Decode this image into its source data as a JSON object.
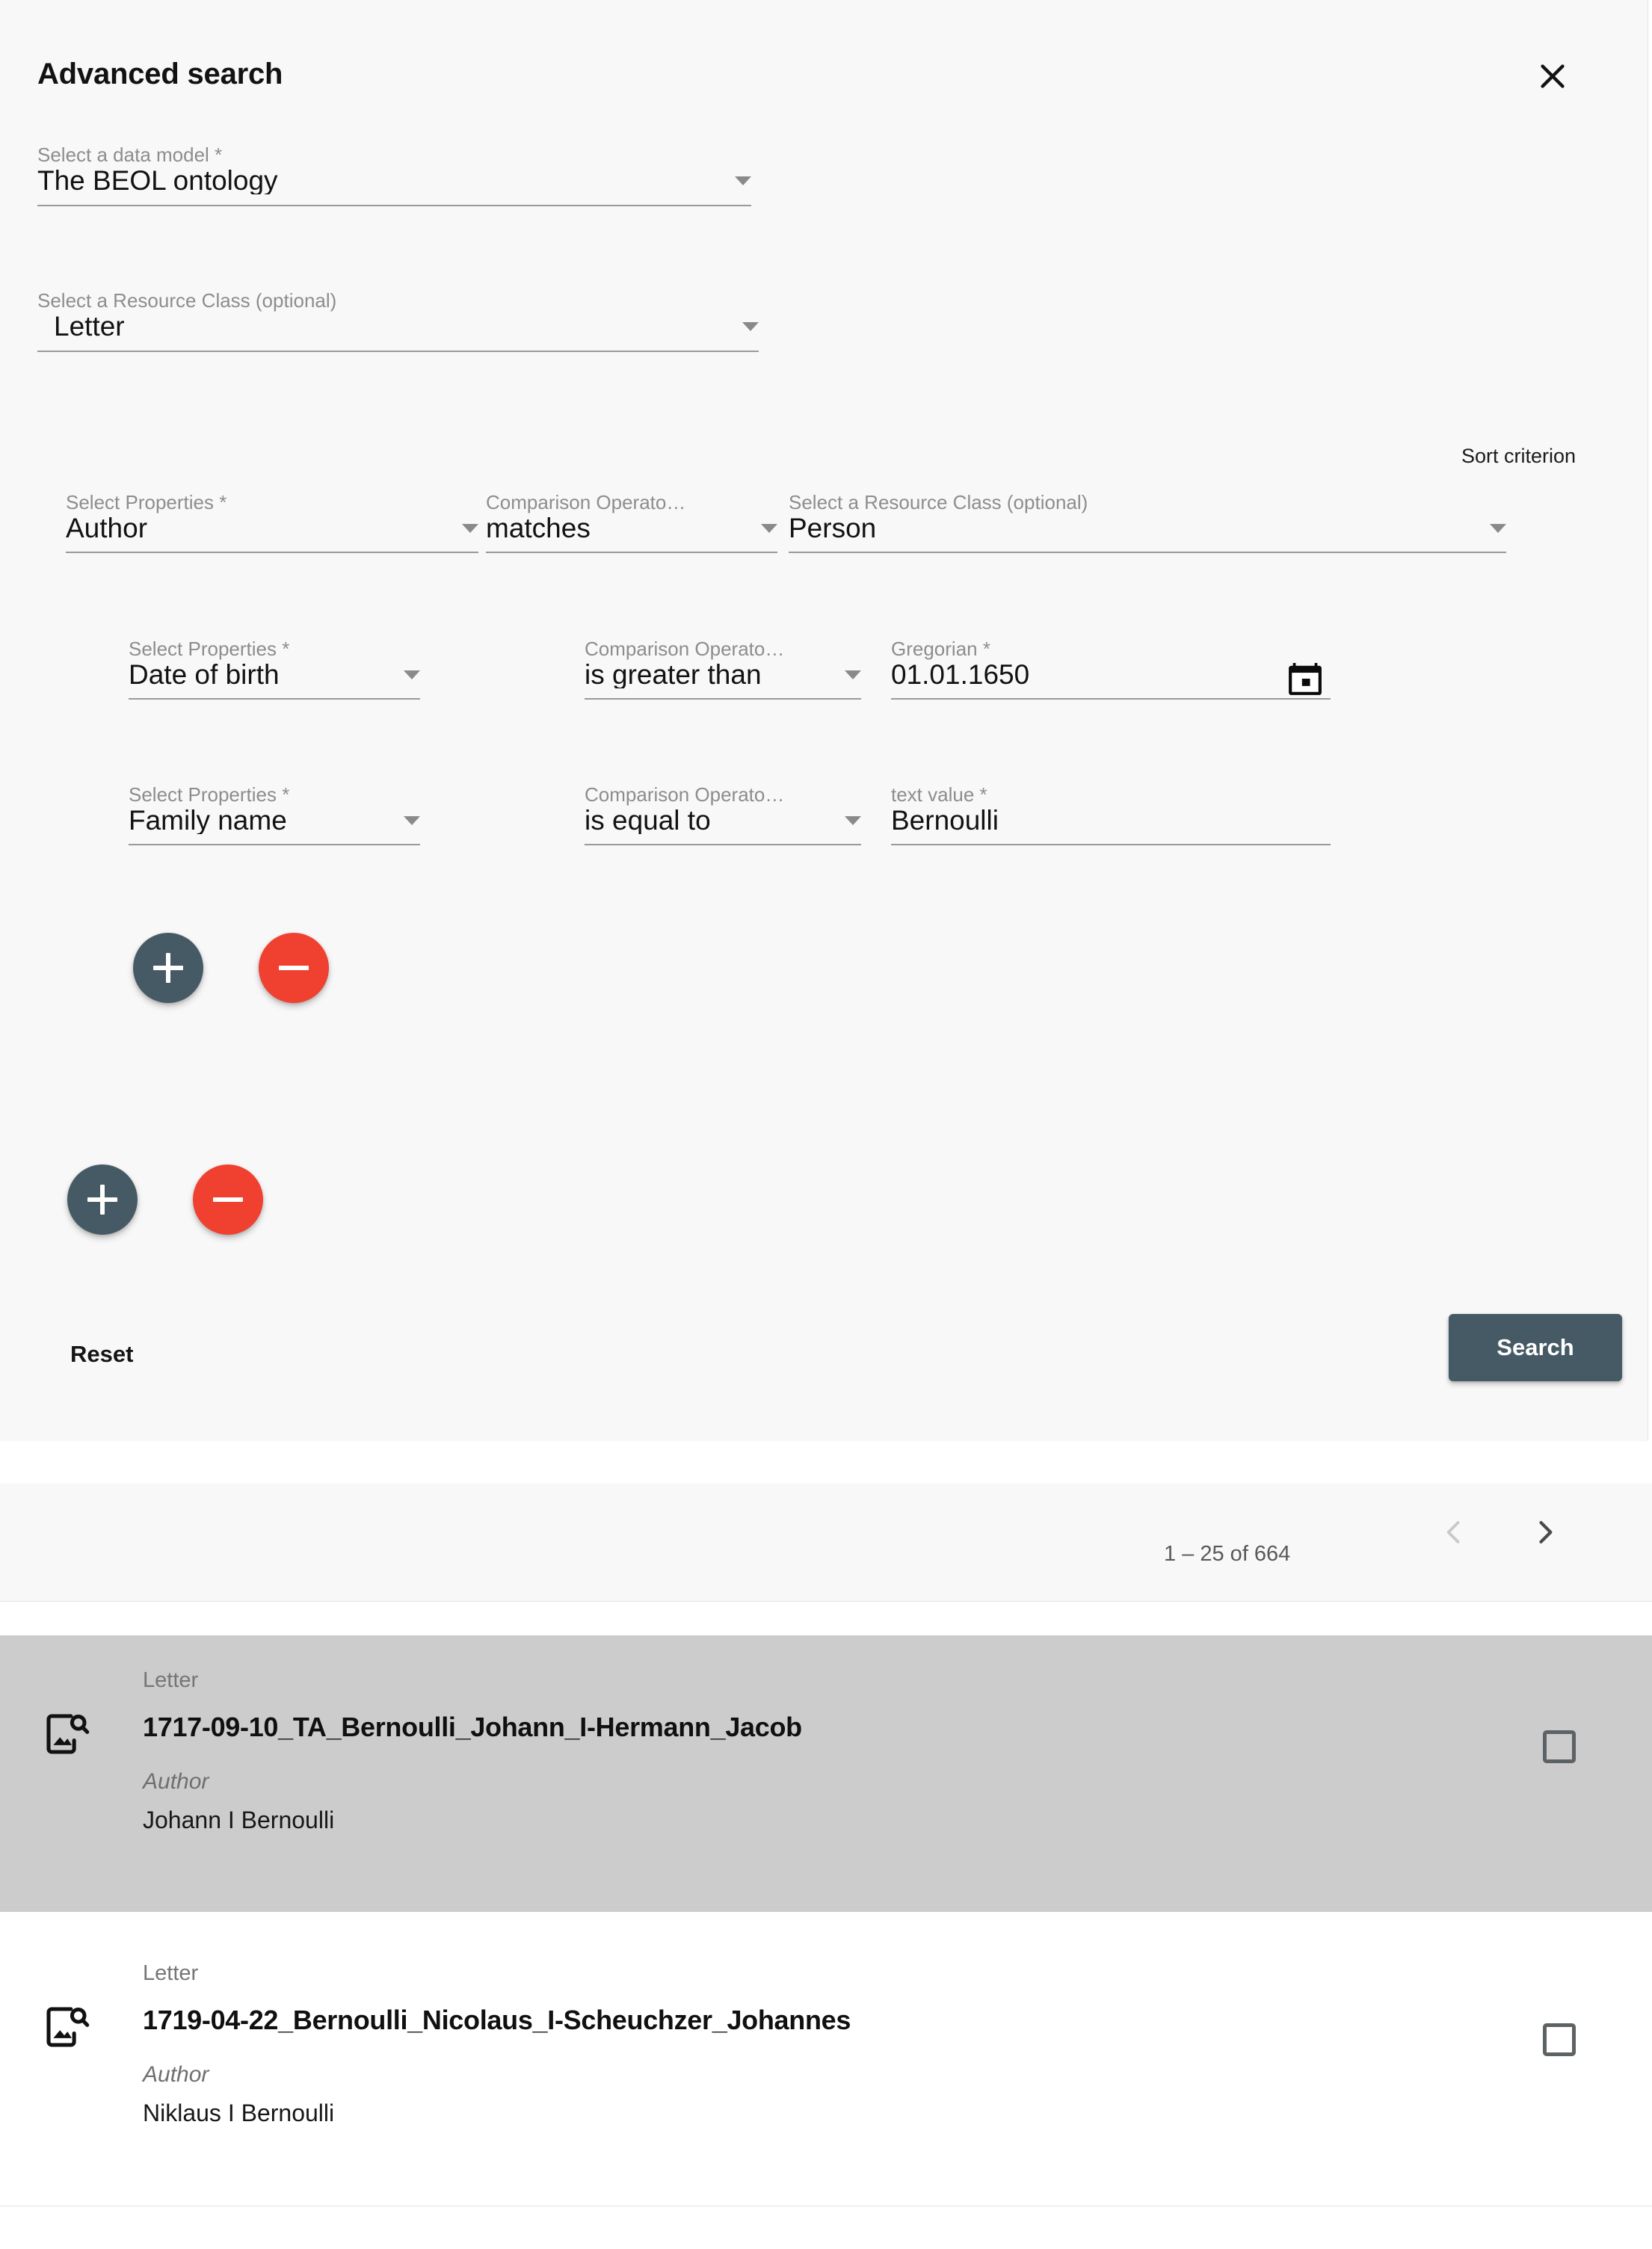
{
  "panel": {
    "title": "Advanced search",
    "close_icon": "close-icon",
    "sort_criterion_label": "Sort criterion",
    "reset_label": "Reset",
    "search_label": "Search"
  },
  "data_model": {
    "label": "Select a data model *",
    "value": "The BEOL ontology"
  },
  "resource_class": {
    "label": "Select a Resource Class (optional)",
    "value": "Letter"
  },
  "property_row_1": {
    "property": {
      "label": "Select Properties *",
      "value": "Author"
    },
    "operator": {
      "label": "Comparison Operato…",
      "value": "matches"
    },
    "resource_class": {
      "label": "Select a Resource Class (optional)",
      "value": "Person"
    }
  },
  "nested_rows": [
    {
      "property": {
        "label": "Select Properties *",
        "value": "Date of birth"
      },
      "operator": {
        "label": "Comparison Operato…",
        "value": "is greater than"
      },
      "value_field": {
        "label": "Gregorian *",
        "value": "01.01.1650",
        "icon": "calendar-icon"
      }
    },
    {
      "property": {
        "label": "Select Properties *",
        "value": "Family name"
      },
      "operator": {
        "label": "Comparison Operato…",
        "value": "is equal to"
      },
      "value_field": {
        "label": "text value *",
        "value": "Bernoulli",
        "icon": null
      }
    }
  ],
  "fab_buttons": {
    "add_icon": "plus-icon",
    "remove_icon": "minus-icon"
  },
  "paginator": {
    "range": "1 – 25 of 664",
    "prev_icon": "chevron-left-icon",
    "next_icon": "chevron-right-icon"
  },
  "results": [
    {
      "type": "Letter",
      "title": "1717-09-10_TA_Bernoulli_Johann_I-Hermann_Jacob",
      "property_label": "Author",
      "property_value": "Johann I Bernoulli",
      "icon": "image-search-icon",
      "selected": true
    },
    {
      "type": "Letter",
      "title": "1719-04-22_Bernoulli_Nicolaus_I-Scheuchzer_Johannes",
      "property_label": "Author",
      "property_value": "Niklaus I Bernoulli",
      "icon": "image-search-icon",
      "selected": false
    }
  ],
  "colors": {
    "panel_bg": "#f8f8f8",
    "accent_dark": "#465a65",
    "accent_red": "#f0402f",
    "selected_row": "#cccccc",
    "label_grey": "#8d8d8d"
  }
}
